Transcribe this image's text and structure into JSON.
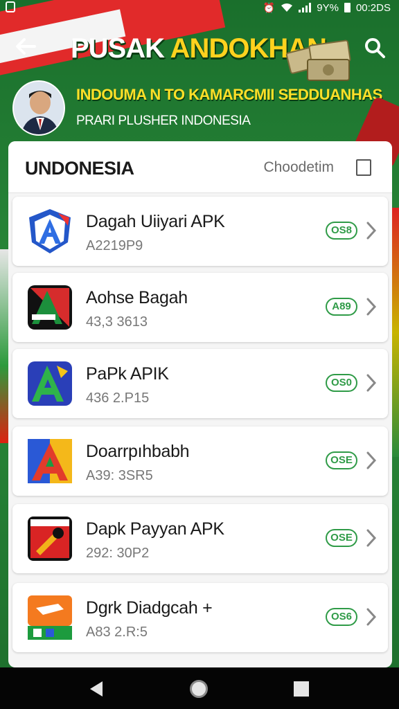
{
  "status_bar": {
    "time": "00:2DS",
    "battery": "9Y%"
  },
  "app_bar": {
    "title_part1": "PUSAK",
    "title_part2": "ANDOKHAN"
  },
  "banner": {
    "title": "INDOUMA N TO KAMARCMII SEDDUANHAS",
    "subtitle": "PRARI PLUSHER INDONESIA"
  },
  "panel": {
    "title": "UNDONESIA",
    "link": "Choodetim"
  },
  "apps": [
    {
      "name": "Dagah Uiiyari APK",
      "meta": "A2219P9",
      "badge": "OS8",
      "icon": "a-logo-blue-icon"
    },
    {
      "name": "Aohse Bagah",
      "meta": "43,3 3613",
      "badge": "A89",
      "icon": "a-logo-green-red-icon"
    },
    {
      "name": "PaPk APIK",
      "meta": "436 2.P15",
      "badge": "OS0",
      "icon": "a-logo-blue-yellow-icon"
    },
    {
      "name": "Doarrpıhbabh",
      "meta": "A39: 3SR5",
      "badge": "OSE",
      "icon": "a-logo-multicolor-icon"
    },
    {
      "name": "Dapk Payyan APK",
      "meta": "292: 30P2",
      "badge": "OSE",
      "icon": "wrench-logo-icon"
    },
    {
      "name": "Dgrk Diadgcah +",
      "meta": "A83 2.R:5",
      "badge": "OS6",
      "icon": "plane-logo-icon"
    }
  ],
  "colors": {
    "accent": "#2f9b47",
    "title_yellow": "#ffd21e",
    "bg_green": "#1f7a2f",
    "flag_red": "#e12a2a"
  }
}
